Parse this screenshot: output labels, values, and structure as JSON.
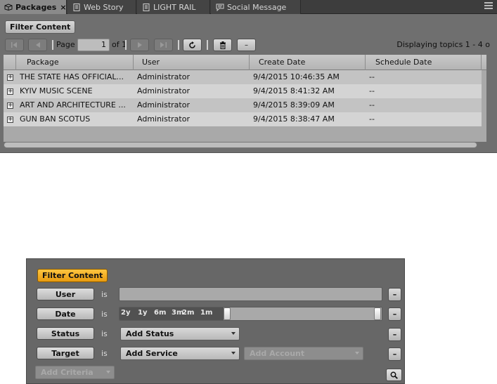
{
  "tabs": [
    {
      "label": "Packages",
      "icon": "packages-icon",
      "active": true
    },
    {
      "label": "Web Story",
      "icon": "document-icon",
      "active": false
    },
    {
      "label": "LIGHT RAIL",
      "icon": "document-icon",
      "active": false
    },
    {
      "label": "Social Message",
      "icon": "message-icon",
      "active": false
    }
  ],
  "toolbar": {
    "filter_label": "Filter Content",
    "page_label": "Page",
    "page_value": "1",
    "of_label": "of 1",
    "minus_label": "–",
    "display_info": "Displaying topics 1 - 4 o"
  },
  "grid": {
    "columns": [
      "Package",
      "User",
      "Create Date",
      "Schedule Date"
    ],
    "rows": [
      {
        "package": "THE STATE HAS OFFICIAL...",
        "user": "Administrator",
        "create_date": "9/4/2015 10:46:35 AM",
        "schedule_date": "--"
      },
      {
        "package": "KYIV MUSIC SCENE",
        "user": "Administrator",
        "create_date": "9/4/2015 8:41:32 AM",
        "schedule_date": "--"
      },
      {
        "package": "ART AND ARCHITECTURE ...",
        "user": "Administrator",
        "create_date": "9/4/2015 8:39:09 AM",
        "schedule_date": "--"
      },
      {
        "package": "GUN BAN SCOTUS",
        "user": "Administrator",
        "create_date": "9/4/2015 8:38:47 AM",
        "schedule_date": "--"
      }
    ]
  },
  "filter": {
    "title": "Filter Content",
    "is_label": "is",
    "minus_label": "–",
    "criteria": {
      "user": "User",
      "date": "Date",
      "status": "Status",
      "target": "Target"
    },
    "date_ticks": [
      "2y",
      "1y",
      "6m",
      "3m",
      "2m",
      "1m"
    ],
    "status_dropdown": "Add Status",
    "service_dropdown": "Add Service",
    "account_dropdown": "Add Account",
    "criteria_dropdown": "Add Criteria"
  },
  "colors": {
    "active_filter": "#f0a820",
    "panel_bg": "#6f6f6f"
  }
}
